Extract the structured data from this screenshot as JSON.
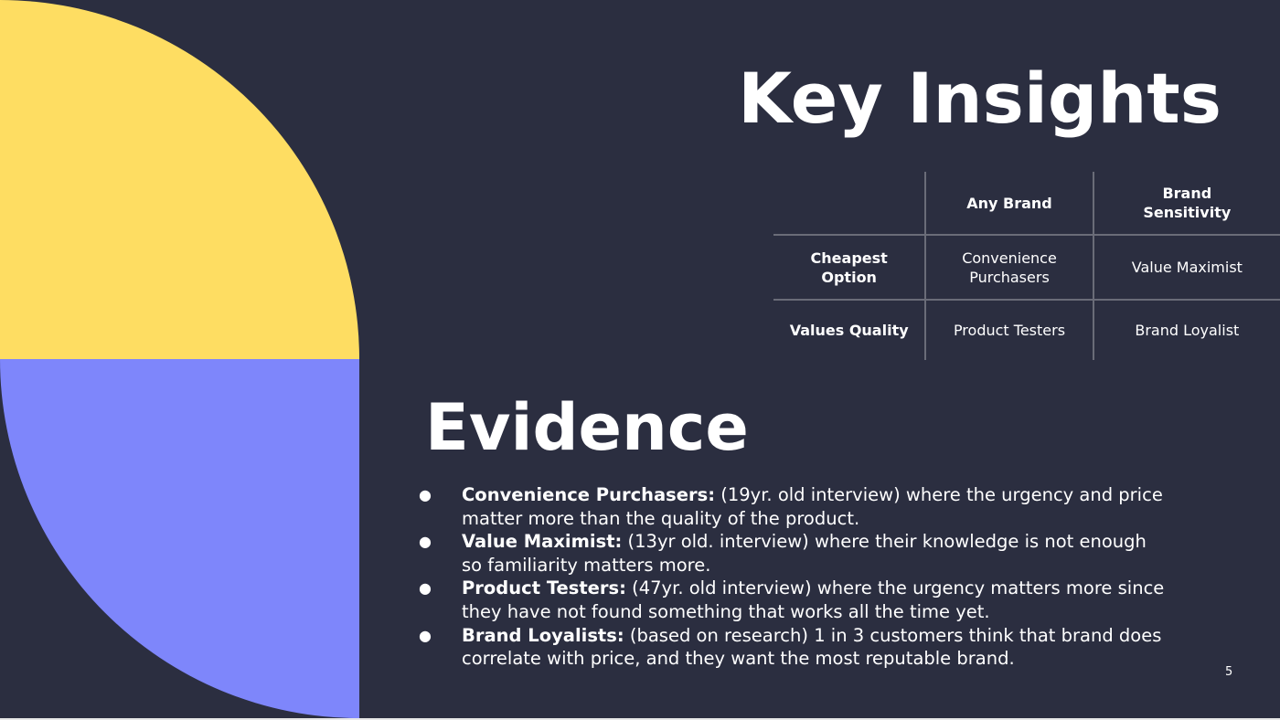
{
  "slide": {
    "title": "Key Insights",
    "evidence_title": "Evidence",
    "page_number": "5",
    "colors": {
      "background": "#2b2e40",
      "yellow": "#fedd62",
      "purple": "#7e86fb"
    }
  },
  "matrix": {
    "col_headers": [
      "Any Brand",
      "Brand Sensitivity"
    ],
    "rows": [
      {
        "label": "Cheapest Option",
        "cells": [
          "Convenience Purchasers",
          "Value Maximist"
        ]
      },
      {
        "label": "Values Quality",
        "cells": [
          "Product Testers",
          "Brand Loyalist"
        ]
      }
    ]
  },
  "evidence": [
    {
      "term": "Convenience Purchasers:",
      "text": "(19yr. old interview) where the urgency and price matter more than the quality of the product."
    },
    {
      "term": "Value Maximist:",
      "text": "(13yr old. interview) where their knowledge is not enough so familiarity matters more."
    },
    {
      "term": "Product Testers:",
      "text": "(47yr. old interview) where the urgency matters more since they have not found something that works all the time yet."
    },
    {
      "term": "Brand Loyalists:",
      "text": "(based on research) 1 in 3 customers think that brand does correlate with price, and they want the most reputable brand."
    }
  ]
}
